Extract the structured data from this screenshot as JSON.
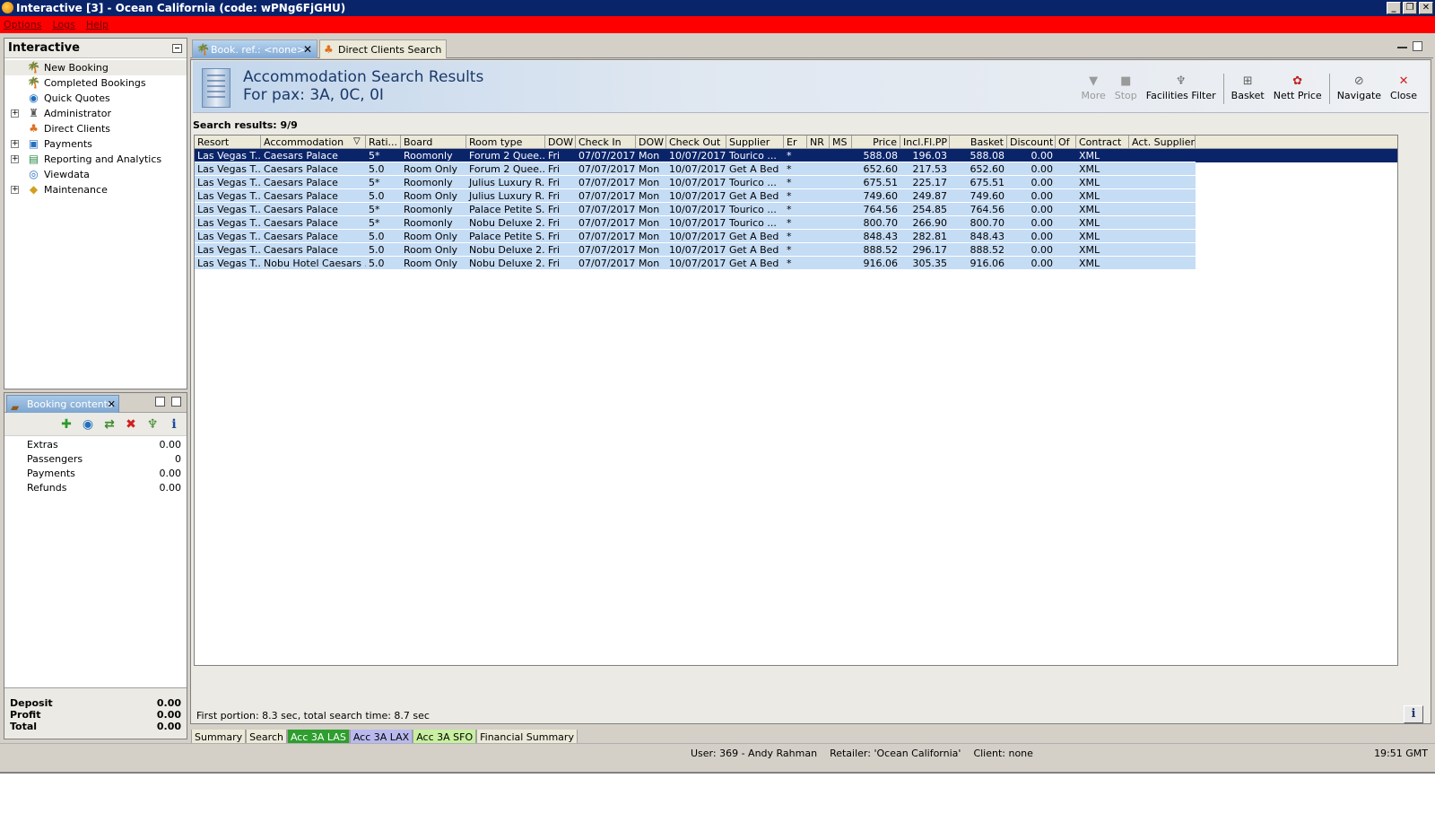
{
  "window": {
    "title": "Interactive [3] - Ocean California (code: wPNg6FjGHU)",
    "controls": [
      "_",
      "❐",
      "✕"
    ]
  },
  "menubar": {
    "items": [
      "Options",
      "Logs",
      "Help"
    ]
  },
  "sidebar": {
    "title": "Interactive",
    "items": [
      {
        "label": "New Booking",
        "expandable": false,
        "icon": "palm-tree-icon"
      },
      {
        "label": "Completed Bookings",
        "expandable": false,
        "icon": "palm-tree-icon"
      },
      {
        "label": "Quick Quotes",
        "expandable": false,
        "icon": "globe-icon"
      },
      {
        "label": "Administrator",
        "expandable": true,
        "icon": "admin-icon"
      },
      {
        "label": "Direct Clients",
        "expandable": false,
        "icon": "direct-clients-icon"
      },
      {
        "label": "Payments",
        "expandable": true,
        "icon": "payments-icon"
      },
      {
        "label": "Reporting and Analytics",
        "expandable": true,
        "icon": "reporting-icon"
      },
      {
        "label": "Viewdata",
        "expandable": false,
        "icon": "viewdata-icon"
      },
      {
        "label": "Maintenance",
        "expandable": true,
        "icon": "maintenance-icon"
      }
    ]
  },
  "booking_contents": {
    "tab_label": "Booking contents",
    "rows": [
      {
        "label": "Extras",
        "value": "0.00"
      },
      {
        "label": "Passengers",
        "value": "0"
      },
      {
        "label": "Payments",
        "value": "0.00"
      },
      {
        "label": "Refunds",
        "value": "0.00"
      }
    ],
    "totals": [
      {
        "label": "Deposit",
        "value": "0.00"
      },
      {
        "label": "Profit",
        "value": "0.00"
      },
      {
        "label": "Total",
        "value": "0.00"
      }
    ]
  },
  "tabs": [
    {
      "label": "Book. ref.: <none>",
      "active": true
    },
    {
      "label": "Direct Clients Search",
      "active": false
    }
  ],
  "results_header": {
    "title": "Accommodation Search Results",
    "subtitle": "For pax: 3A, 0C, 0I"
  },
  "toolbar": {
    "buttons": [
      {
        "label": "More",
        "enabled": false
      },
      {
        "label": "Stop",
        "enabled": false
      },
      {
        "label": "Facilities Filter",
        "enabled": true
      },
      {
        "label": "Basket",
        "enabled": true
      },
      {
        "label": "Nett Price",
        "enabled": true
      },
      {
        "label": "Navigate",
        "enabled": true
      },
      {
        "label": "Close",
        "enabled": true
      }
    ]
  },
  "search_count": "Search results: 9/9",
  "table": {
    "columns": [
      "Resort",
      "Accommodation",
      "Rati...",
      "Board",
      "Room type",
      "DOW",
      "Check In",
      "DOW",
      "Check Out",
      "Supplier",
      "Er",
      "NR",
      "MS",
      "Price",
      "Incl.Fl.PP",
      "Basket",
      "Discount",
      "Of",
      "Contract",
      "Act. Supplier"
    ],
    "rows": [
      [
        "Las Vegas T...",
        "Caesars Palace",
        "5*",
        "Roomonly",
        "Forum 2 Quee...",
        "Fri",
        "07/07/2017",
        "Mon",
        "10/07/2017",
        "Tourico ...",
        "*",
        "",
        "",
        "588.08",
        "196.03",
        "588.08",
        "0.00",
        "",
        "XML",
        ""
      ],
      [
        "Las Vegas T...",
        "Caesars Palace",
        "5.0",
        "Room Only",
        "Forum 2 Quee...",
        "Fri",
        "07/07/2017",
        "Mon",
        "10/07/2017",
        "Get A Bed",
        "*",
        "",
        "",
        "652.60",
        "217.53",
        "652.60",
        "0.00",
        "",
        "XML",
        ""
      ],
      [
        "Las Vegas T...",
        "Caesars Palace",
        "5*",
        "Roomonly",
        "Julius Luxury R...",
        "Fri",
        "07/07/2017",
        "Mon",
        "10/07/2017",
        "Tourico ...",
        "*",
        "",
        "",
        "675.51",
        "225.17",
        "675.51",
        "0.00",
        "",
        "XML",
        ""
      ],
      [
        "Las Vegas T...",
        "Caesars Palace",
        "5.0",
        "Room Only",
        "Julius Luxury R...",
        "Fri",
        "07/07/2017",
        "Mon",
        "10/07/2017",
        "Get A Bed",
        "*",
        "",
        "",
        "749.60",
        "249.87",
        "749.60",
        "0.00",
        "",
        "XML",
        ""
      ],
      [
        "Las Vegas T...",
        "Caesars Palace",
        "5*",
        "Roomonly",
        "Palace Petite S...",
        "Fri",
        "07/07/2017",
        "Mon",
        "10/07/2017",
        "Tourico ...",
        "*",
        "",
        "",
        "764.56",
        "254.85",
        "764.56",
        "0.00",
        "",
        "XML",
        ""
      ],
      [
        "Las Vegas T...",
        "Caesars Palace",
        "5*",
        "Roomonly",
        "Nobu Deluxe 2...",
        "Fri",
        "07/07/2017",
        "Mon",
        "10/07/2017",
        "Tourico ...",
        "*",
        "",
        "",
        "800.70",
        "266.90",
        "800.70",
        "0.00",
        "",
        "XML",
        ""
      ],
      [
        "Las Vegas T...",
        "Caesars Palace",
        "5.0",
        "Room Only",
        "Palace Petite S...",
        "Fri",
        "07/07/2017",
        "Mon",
        "10/07/2017",
        "Get A Bed",
        "*",
        "",
        "",
        "848.43",
        "282.81",
        "848.43",
        "0.00",
        "",
        "XML",
        ""
      ],
      [
        "Las Vegas T...",
        "Caesars Palace",
        "5.0",
        "Room Only",
        "Nobu Deluxe 2...",
        "Fri",
        "07/07/2017",
        "Mon",
        "10/07/2017",
        "Get A Bed",
        "*",
        "",
        "",
        "888.52",
        "296.17",
        "888.52",
        "0.00",
        "",
        "XML",
        ""
      ],
      [
        "Las Vegas T...",
        "Nobu Hotel Caesars ...",
        "5.0",
        "Room Only",
        "Nobu Deluxe 2...",
        "Fri",
        "07/07/2017",
        "Mon",
        "10/07/2017",
        "Get A Bed",
        "*",
        "",
        "",
        "916.06",
        "305.35",
        "916.06",
        "0.00",
        "",
        "XML",
        ""
      ]
    ],
    "selected_row": 0
  },
  "status_line": "First portion: 8.3 sec, total search time: 8.7 sec",
  "info_button": "i",
  "bottom_tabs": [
    {
      "label": "Summary",
      "color": "#ece9d8",
      "text": "#000000"
    },
    {
      "label": "Search",
      "color": "#ece9d8",
      "text": "#000000"
    },
    {
      "label": "Acc 3A LAS",
      "color": "#2e9e2e",
      "text": "#ffffff"
    },
    {
      "label": "Acc 3A LAX",
      "color": "#b9b9f0",
      "text": "#000000"
    },
    {
      "label": "Acc 3A SFO",
      "color": "#c8f0a0",
      "text": "#000000"
    },
    {
      "label": "Financial Summary",
      "color": "#ece9d8",
      "text": "#000000"
    }
  ],
  "statusbar": {
    "user": "User: 369 - Andy Rahman",
    "retailer": "Retailer: 'Ocean California'",
    "client": "Client: none",
    "time": "19:51 GMT"
  }
}
